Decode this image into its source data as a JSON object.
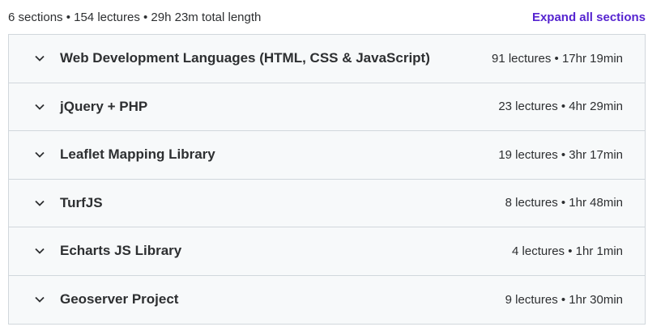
{
  "header": {
    "summary": "6 sections • 154 lectures • 29h 23m total length",
    "expand_label": "Expand all sections"
  },
  "sections": [
    {
      "title": "Web Development Languages (HTML, CSS & JavaScript)",
      "meta": "91 lectures • 17hr 19min"
    },
    {
      "title": "jQuery + PHP",
      "meta": "23 lectures • 4hr 29min"
    },
    {
      "title": "Leaflet Mapping Library",
      "meta": "19 lectures • 3hr 17min"
    },
    {
      "title": "TurfJS",
      "meta": "8 lectures • 1hr 48min"
    },
    {
      "title": "Echarts JS Library",
      "meta": "4 lectures • 1hr 1min"
    },
    {
      "title": "Geoserver Project",
      "meta": "9 lectures • 1hr 30min"
    }
  ],
  "icons": {
    "chevron": "chevron-down-icon"
  },
  "colors": {
    "link": "#5624d0",
    "text": "#2d2f31",
    "section_bg": "#f7f9fa",
    "border": "#d1d7dc"
  }
}
